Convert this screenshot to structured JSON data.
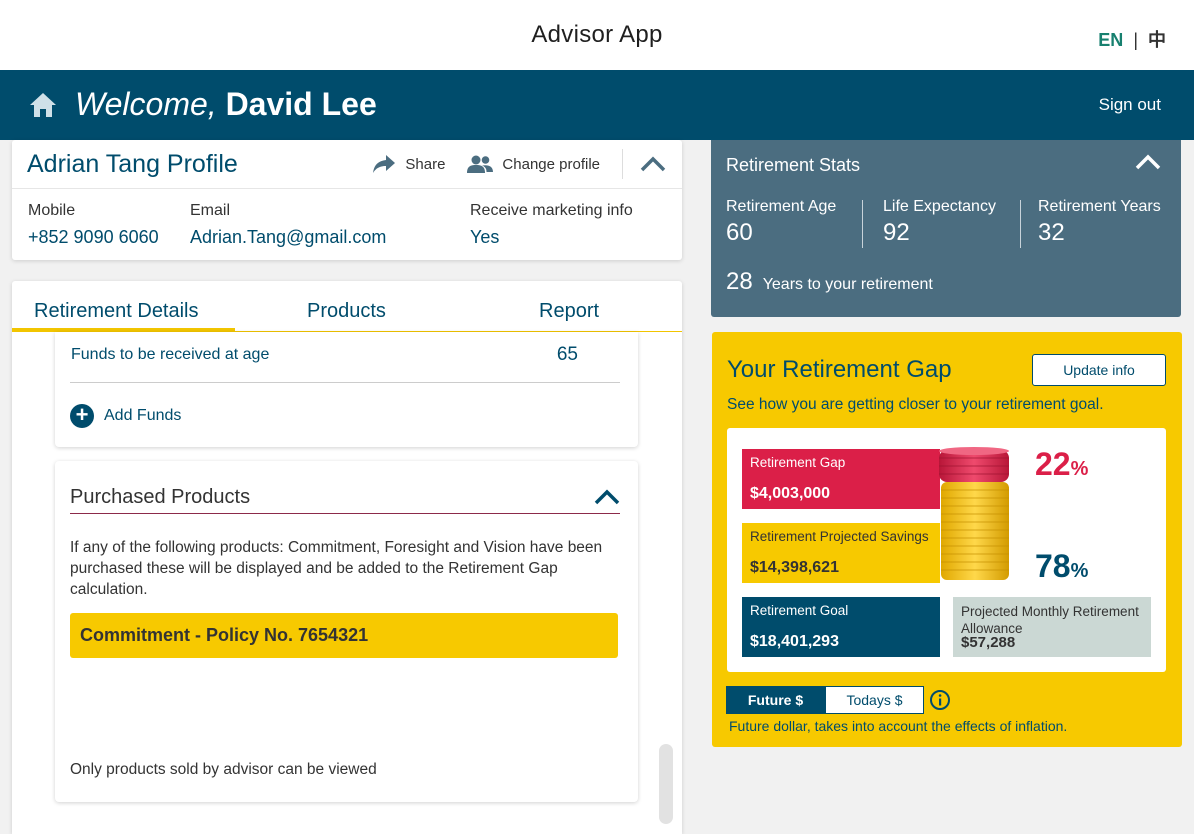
{
  "app": {
    "title": "Advisor App",
    "lang_en": "EN",
    "lang_sep": "|",
    "lang_zh": "中"
  },
  "header": {
    "welcome": "Welcome,",
    "user_name": "David Lee",
    "sign_out": "Sign out"
  },
  "profile": {
    "title": "Adrian Tang Profile",
    "share_label": "Share",
    "change_label": "Change profile",
    "mobile_label": "Mobile",
    "mobile_value": "+852 9090 6060",
    "email_label": "Email",
    "email_value": "Adrian.Tang@gmail.com",
    "marketing_label": "Receive marketing info",
    "marketing_value": "Yes"
  },
  "tabs": [
    {
      "label": "Retirement Details",
      "active": true
    },
    {
      "label": "Products",
      "active": false
    },
    {
      "label": "Report",
      "active": false
    }
  ],
  "funds": {
    "label": "Funds to be received at age",
    "value": "65",
    "add_label": "Add Funds"
  },
  "purchased": {
    "title": "Purchased Products",
    "description": "If any of the following products: Commitment, Foresight and Vision have been purchased these will be displayed and be added to the Retirement Gap calculation.",
    "policy": "Commitment - Policy No. 7654321",
    "footer": "Only products sold by advisor can be viewed"
  },
  "stats": {
    "title": "Retirement Stats",
    "age_label": "Retirement Age",
    "age_value": "60",
    "life_label": "Life Expectancy",
    "life_value": "92",
    "years_label": "Retirement Years",
    "years_value": "32",
    "to_retire_num": "28",
    "to_retire_text": "Years to your retirement"
  },
  "gap": {
    "title": "Your Retirement Gap",
    "update_btn": "Update info",
    "subtitle": "See how you are getting closer to your retirement goal.",
    "gap_label": "Retirement Gap",
    "gap_value": "$4,003,000",
    "savings_label": "Retirement Projected Savings",
    "savings_value": "$14,398,621",
    "goal_label": "Retirement Goal",
    "goal_value": "$18,401,293",
    "monthly_label": "Projected Monthly Retirement Allowance",
    "monthly_value": "$57,288",
    "gap_pct": "22",
    "savings_pct": "78",
    "pct_sign": "%",
    "toggle_future": "Future $",
    "toggle_today": "Todays $",
    "note": "Future dollar, takes into account the effects of inflation."
  },
  "colors": {
    "primary": "#004c6c",
    "accent": "#f7c900",
    "gap_red": "#db1f48",
    "stats_bg": "#4b6d80",
    "teal": "#17806f"
  },
  "icons": [
    "home-icon",
    "share-icon",
    "people-icon",
    "chevron-up-icon",
    "plus-circle-icon",
    "coins-icon",
    "info-icon"
  ]
}
